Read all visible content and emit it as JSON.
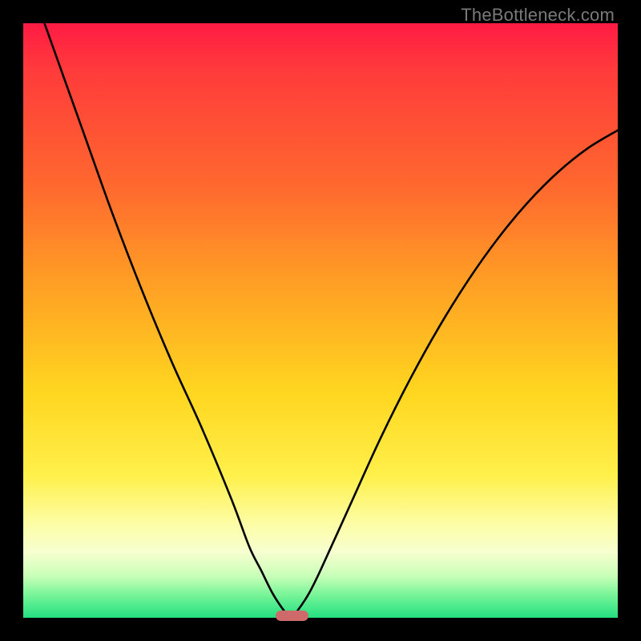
{
  "watermark": "TheBottleneck.com",
  "chart_data": {
    "type": "line",
    "title": "",
    "xlabel": "",
    "ylabel": "",
    "xlim": [
      0,
      100
    ],
    "ylim": [
      0,
      100
    ],
    "grid": false,
    "series": [
      {
        "name": "bottleneck-curve",
        "x": [
          0,
          5,
          10,
          15,
          20,
          25,
          30,
          35,
          38,
          40,
          42,
          44,
          45,
          46,
          48,
          50,
          55,
          60,
          65,
          70,
          75,
          80,
          85,
          90,
          95,
          100
        ],
        "y": [
          110,
          96,
          82,
          68,
          55,
          43,
          32,
          20,
          12,
          8,
          4,
          1,
          0,
          1,
          4,
          8,
          19,
          30,
          40,
          49,
          57,
          64,
          70,
          75,
          79,
          82
        ]
      }
    ],
    "marker": {
      "x_start": 42.5,
      "x_end": 48,
      "y": 0
    },
    "background_gradient": {
      "stops": [
        {
          "pos": 0.0,
          "color": "#ff1b44"
        },
        {
          "pos": 0.28,
          "color": "#ff6a2e"
        },
        {
          "pos": 0.62,
          "color": "#ffd61f"
        },
        {
          "pos": 0.84,
          "color": "#fdfda3"
        },
        {
          "pos": 0.96,
          "color": "#7cf59a"
        },
        {
          "pos": 1.0,
          "color": "#22e07f"
        }
      ]
    }
  }
}
